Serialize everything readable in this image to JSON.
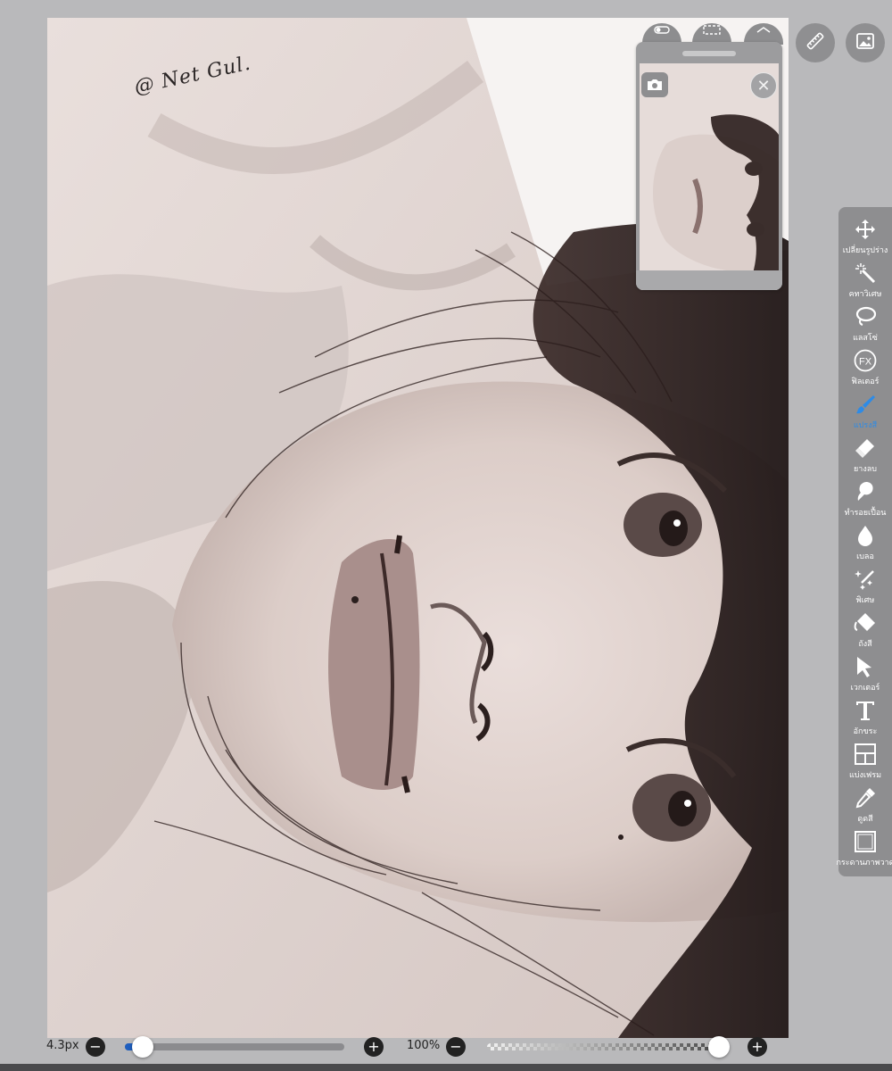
{
  "canvas": {
    "signature": "@ Net Gul."
  },
  "top_buttons": {
    "ruler_icon": "ruler-icon",
    "gallery_icon": "image-icon"
  },
  "preview": {
    "camera_icon": "camera-icon",
    "close_icon": "close-icon",
    "close_glyph": "✕"
  },
  "toolbar": {
    "items": [
      {
        "label": "เปลี่ยนรูปร่าง",
        "icon": "move-arrows-icon"
      },
      {
        "label": "คทาวิเศษ",
        "icon": "magic-wand-icon"
      },
      {
        "label": "แลสโซ่",
        "icon": "lasso-icon"
      },
      {
        "label": "ฟิลเตอร์",
        "icon": "fx-icon"
      },
      {
        "label": "แปรงสี",
        "icon": "brush-icon"
      },
      {
        "label": "ยางลบ",
        "icon": "eraser-icon"
      },
      {
        "label": "ทำรอยเปื้อน",
        "icon": "smudge-icon"
      },
      {
        "label": "เบลอ",
        "icon": "blur-drop-icon"
      },
      {
        "label": "พิเศษ",
        "icon": "special-effect-icon"
      },
      {
        "label": "ถังสี",
        "icon": "paint-bucket-icon"
      },
      {
        "label": "เวกเตอร์",
        "icon": "vector-cursor-icon"
      },
      {
        "label": "อักขระ",
        "icon": "text-icon"
      },
      {
        "label": "แบ่งเฟรม",
        "icon": "frame-divider-icon"
      },
      {
        "label": "ดูดสี",
        "icon": "eyedropper-icon"
      },
      {
        "label": "กระดานภาพวาด",
        "icon": "canvas-icon"
      }
    ],
    "active_index": 4,
    "active_color": "#2e8be6"
  },
  "bottom": {
    "brush_size": "4.3px",
    "brush_size_fraction": 0.05,
    "opacity": "100%",
    "opacity_fraction": 1.0,
    "minus": "−",
    "plus": "+"
  }
}
